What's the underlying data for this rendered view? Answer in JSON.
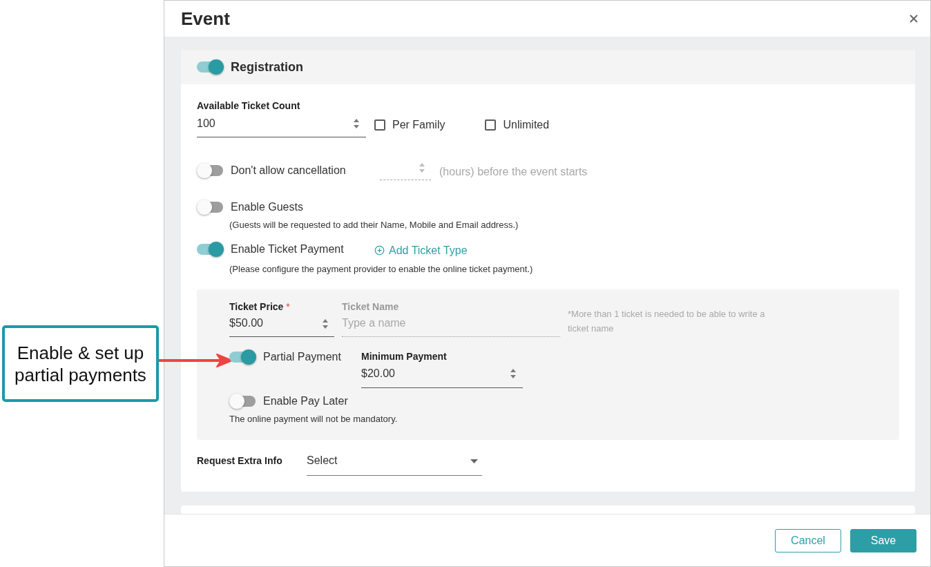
{
  "callout": {
    "text": "Enable & set up partial payments"
  },
  "dialog": {
    "title": "Event",
    "registration": {
      "label": "Registration",
      "on": true,
      "ticket_count": {
        "label": "Available Ticket Count",
        "value": "100"
      },
      "checkboxes": [
        {
          "label": "Per Family",
          "checked": false
        },
        {
          "label": "Unlimited",
          "checked": false
        }
      ],
      "cancellation": {
        "label": "Don't allow cancellation",
        "on": false,
        "suffix": "(hours) before the event starts"
      },
      "guests": {
        "label": "Enable Guests",
        "on": false,
        "note": "(Guests will be requested to add their Name, Mobile and Email address.)"
      },
      "ticket_payment": {
        "label": "Enable Ticket Payment",
        "on": true,
        "link": "Add Ticket Type",
        "note": "(Please configure the payment provider to enable the online ticket payment.)"
      },
      "ticket": {
        "price": {
          "label": "Ticket Price",
          "required_mark": "*",
          "value": "$50.00"
        },
        "name": {
          "label": "Ticket Name",
          "placeholder": "Type a name",
          "disabled": true
        },
        "name_note": "*More than 1 ticket is needed to be able to write a ticket name",
        "partial_payment": {
          "label": "Partial Payment",
          "on": true
        },
        "minimum_payment": {
          "label": "Minimum Payment",
          "value": "$20.00"
        },
        "pay_later": {
          "label": "Enable Pay Later",
          "on": false,
          "note": "The online payment will not be mandatory."
        }
      },
      "extra_info": {
        "label": "Request Extra Info",
        "value": "Select"
      }
    },
    "buttons": [
      {
        "label": "Cancel",
        "kind": "secondary"
      },
      {
        "label": "Save",
        "kind": "primary"
      }
    ]
  }
}
